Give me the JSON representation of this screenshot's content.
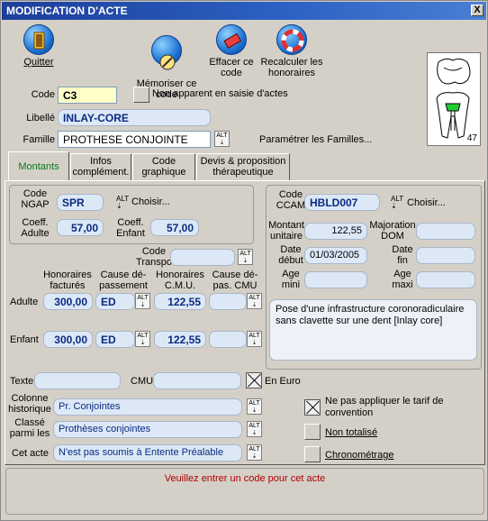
{
  "window": {
    "title": "MODIFICATION D'ACTE",
    "close": "X"
  },
  "toolbar": {
    "quit": "Quitter",
    "memorize": "Mémoriser ce\ncode",
    "erase": "Effacer ce\ncode",
    "recalc": "Recalculer les\nhonoraires"
  },
  "header": {
    "code_label": "Code",
    "code_value": "C3",
    "hidden_label": "Non apparent en saisie d'actes",
    "libelle_label": "Libellé",
    "libelle_value": "INLAY-CORE",
    "famille_label": "Famille",
    "famille_value": "PROTHESE CONJOINTE",
    "famille_link": "Paramétrer les Familles...",
    "tooth_number": "47"
  },
  "alt_label": "ALT",
  "tabs": [
    {
      "label": "Montants"
    },
    {
      "label": "Infos\ncomplément."
    },
    {
      "label": "Code\ngraphique"
    },
    {
      "label": "Devis & proposition\nthérapeutique"
    }
  ],
  "ngap": {
    "code_label": "Code\nNGAP",
    "code_value": "SPR",
    "choose": "Choisir...",
    "coeff_adult_label": "Coeff.\nAdulte",
    "coeff_adult_value": "57,00",
    "coeff_child_label": "Coeff.\nEnfant",
    "coeff_child_value": "57,00"
  },
  "fees": {
    "transpo_label": "Code\nTranspo",
    "col_fees": "Honoraires\nfacturés",
    "col_cause": "Cause dé-\npassement",
    "col_cmu": "Honoraires\nC.M.U.",
    "col_cause_cmu": "Cause dé-\npas. CMU",
    "adult_label": "Adulte",
    "adult_fee": "300,00",
    "adult_cause": "ED",
    "adult_cmu": "122,55",
    "child_label": "Enfant",
    "child_fee": "300,00",
    "child_cause": "ED",
    "child_cmu": "122,55"
  },
  "ccam": {
    "code_label": "Code\nCCAM",
    "code_value": "HBLD007",
    "choose": "Choisir...",
    "unit_label": "Montant\nunitaire",
    "unit_value": "122,55",
    "dom_label": "Majoration\nDOM",
    "start_label": "Date\ndébut",
    "start_value": "01/03/2005",
    "end_label": "Date\nfin",
    "age_min_label": "Age\nmini",
    "age_max_label": "Age\nmaxi",
    "description": "Pose d'une infrastructure coronoradiculaire sans clavette sur une dent [Inlay core]"
  },
  "bottom": {
    "texte_label": "Texte",
    "cmu_label": "CMU",
    "euro_label": "En Euro",
    "hist_label": "Colonne\nhistorique",
    "hist_value": "Pr. Conjointes",
    "class_label": "Classé\nparmi les",
    "class_value": "Prothèses conjointes",
    "cet_label": "Cet acte",
    "cet_value": "N'est pas soumis à Entente Préalable",
    "no_tariff": "Ne pas appliquer le tarif de\nconvention",
    "not_total": "Non totalisé",
    "chrono": "Chronométrage"
  },
  "status": "Veuillez entrer un code pour cet acte",
  "colors": {
    "title_bar": "#2d62c4",
    "field_bg": "#dce8f6",
    "field_text": "#0a2b80",
    "status_text": "#b00000",
    "active_tab": "#0a7a1a"
  }
}
